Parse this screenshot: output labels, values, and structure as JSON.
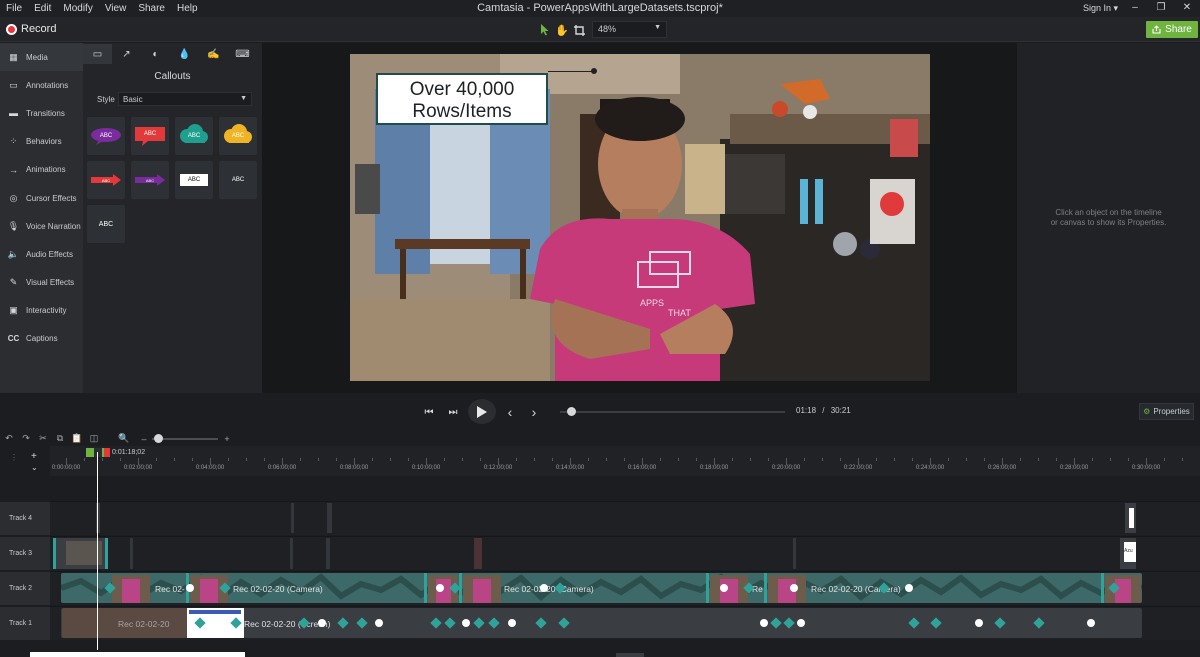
{
  "menubar": {
    "items": [
      "File",
      "Edit",
      "Modify",
      "View",
      "Share",
      "Help"
    ],
    "window_title": "Camtasia - PowerAppsWithLargeDatasets.tscproj*",
    "signin": "Sign In ▾"
  },
  "toolbar": {
    "record_label": "Record",
    "zoom_value": "48%",
    "share_label": "Share"
  },
  "sidebar": {
    "items": [
      {
        "label": "Media",
        "icon": "media-icon"
      },
      {
        "label": "Annotations",
        "icon": "annotations-icon"
      },
      {
        "label": "Transitions",
        "icon": "transitions-icon"
      },
      {
        "label": "Behaviors",
        "icon": "behaviors-icon"
      },
      {
        "label": "Animations",
        "icon": "animations-icon"
      },
      {
        "label": "Cursor Effects",
        "icon": "cursor-icon"
      },
      {
        "label": "Voice Narration",
        "icon": "microphone-icon"
      },
      {
        "label": "Audio Effects",
        "icon": "audio-icon"
      },
      {
        "label": "Visual Effects",
        "icon": "visual-effects-icon"
      },
      {
        "label": "Interactivity",
        "icon": "interactivity-icon"
      },
      {
        "label": "Captions",
        "icon": "cc-icon"
      }
    ]
  },
  "panel": {
    "title": "Callouts",
    "style_label": "Style",
    "style_value": "Basic",
    "tiles": [
      "ABC",
      "ABC",
      "ABC",
      "ABC",
      "ABC",
      "ABC",
      "ABC",
      "ABC",
      "ABC"
    ]
  },
  "canvas": {
    "callout_line1": "Over 40,000",
    "callout_line2": "Rows/Items",
    "shirt_text_1": "APPS",
    "shirt_text_2": "THAT"
  },
  "properties": {
    "hint_line1": "Click an object on the timeline",
    "hint_line2": "or canvas to show its Properties.",
    "button_label": "Properties"
  },
  "playback": {
    "time_current": "01:18",
    "time_total": "30:21",
    "separator": "/",
    "progress": 0.043
  },
  "timeline": {
    "playhead_time": "0:01:18;02",
    "ruler": [
      "0:00:00;00",
      "0:02:00;00",
      "0:04:00;00",
      "0:06:00;00",
      "0:08:00;00",
      "0:10:00;00",
      "0:12:00;00",
      "0:14:00;00",
      "0:16:00;00",
      "0:18:00;00",
      "0:20:00;00",
      "0:22:00;00",
      "0:24:00;00",
      "0:26:00;00",
      "0:28:00;00",
      "0:30:00;00"
    ],
    "tracks": [
      "Track 4",
      "Track 3",
      "Track 2",
      "Track 1"
    ],
    "clip_labels": {
      "cam_a": "Rec 02-",
      "cam_b": "Rec 02-02-20 (Camera)",
      "cam_c": "Rec 02-02-20 (Camera)",
      "cam_d": "Re",
      "cam_e": "Rec 02-02-20 (Camera)",
      "screen_a": "Rec 02-02-20",
      "screen_b": "Rec 02-02-20 (Screen)",
      "track3_label": "Azu"
    }
  },
  "colors": {
    "accent_green": "#6fb43f",
    "record_red": "#e8363b",
    "clip_teal": "#3a7f7a",
    "keyframe_teal": "#2fa39a"
  }
}
